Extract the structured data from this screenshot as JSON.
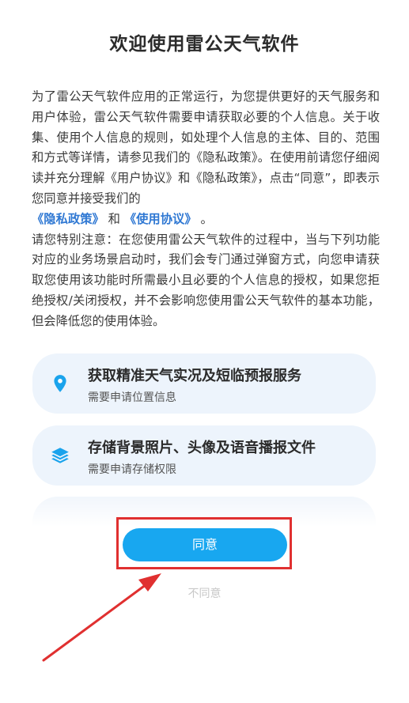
{
  "title": "欢迎使用雷公天气软件",
  "para1_part1": "为了雷公天气软件应用的正常运行，为您提供更好的天气服务和用户体验，雷公天气软件需要申请获取必要的个人信息。关于收集、使用个人信息的规则，如处理个人信息的主体、目的、范围和方式等详情，请参见我们的《隐私政策》。在使用前请您仔细阅读并充分理解《用户协议》和《隐私政策》，点击“同意”，即表示您同意并接受我们的",
  "link_privacy": "《隐私政策》",
  "and_text": " 和 ",
  "link_terms": "《使用协议》",
  "para1_end": " 。",
  "para2": "请您特别注意：在您使用雷公天气软件的过程中，当与下列功能对应的业务场景启动时，我们会专门通过弹窗方式，向您申请获取您使用该功能时所需最小且必要的个人信息的授权，如果您拒绝授权/关闭授权，并不会影响您使用雷公天气软件的基本功能，但会降低您的使用体验。",
  "cards": [
    {
      "title": "获取精准天气实况及短临预报服务",
      "subtitle": "需要申请位置信息",
      "icon": "location-pin-icon"
    },
    {
      "title": "存储背景照片、头像及语音播报文件",
      "subtitle": "需要申请存储权限",
      "icon": "layers-icon"
    }
  ],
  "agree_label": "同意",
  "disagree_label": "不同意",
  "colors": {
    "accent": "#18a7f0",
    "highlight": "#e03030",
    "link": "#2f78d3",
    "card_bg": "#edf4fc"
  }
}
